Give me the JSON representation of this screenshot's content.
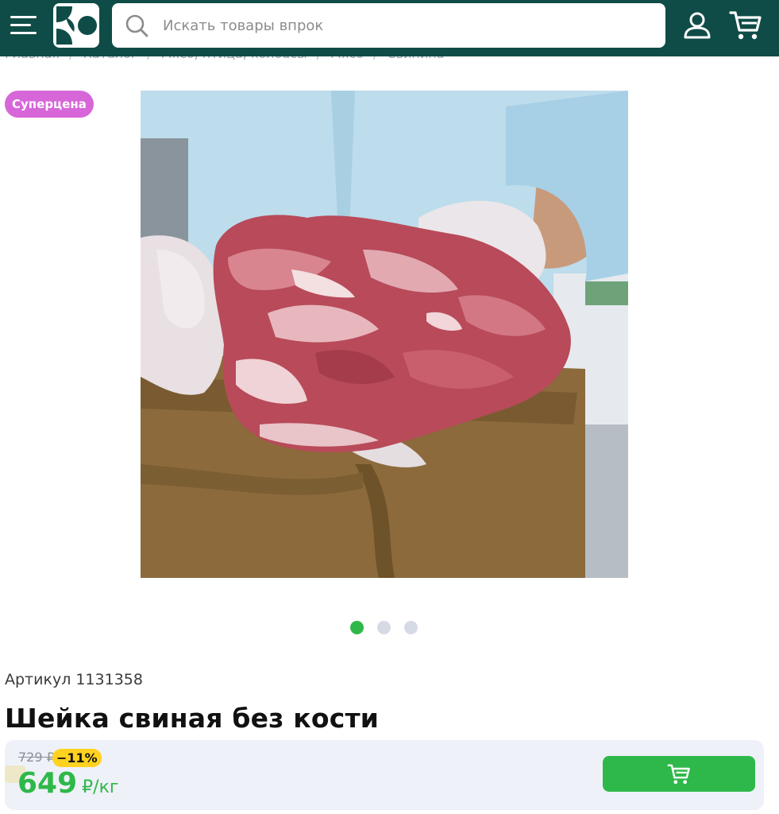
{
  "header": {
    "search_placeholder": "Искать товары впрок"
  },
  "breadcrumb": [
    "Главная",
    "Каталог",
    "Мясо, птица, колбасы",
    "Мясо",
    "Свинина"
  ],
  "product": {
    "badge": "Суперцена",
    "article_label": "Артикул",
    "article_number": "1131358",
    "title": "Шейка свиная без кости",
    "old_price": "729 ₽",
    "discount": "−11%",
    "price": "649",
    "price_unit": "₽/кг"
  },
  "gallery": {
    "total_images": 3,
    "active_index": 0
  },
  "colors": {
    "header_bg": "#0f4c47",
    "accent_green": "#2fb84a",
    "badge_purple": "#d766d9",
    "discount_yellow": "#ffd21f"
  },
  "icons": {
    "menu": "hamburger-menu-icon",
    "search": "search-icon",
    "user": "user-icon",
    "cart": "cart-icon",
    "add_to_cart": "cart-icon"
  }
}
